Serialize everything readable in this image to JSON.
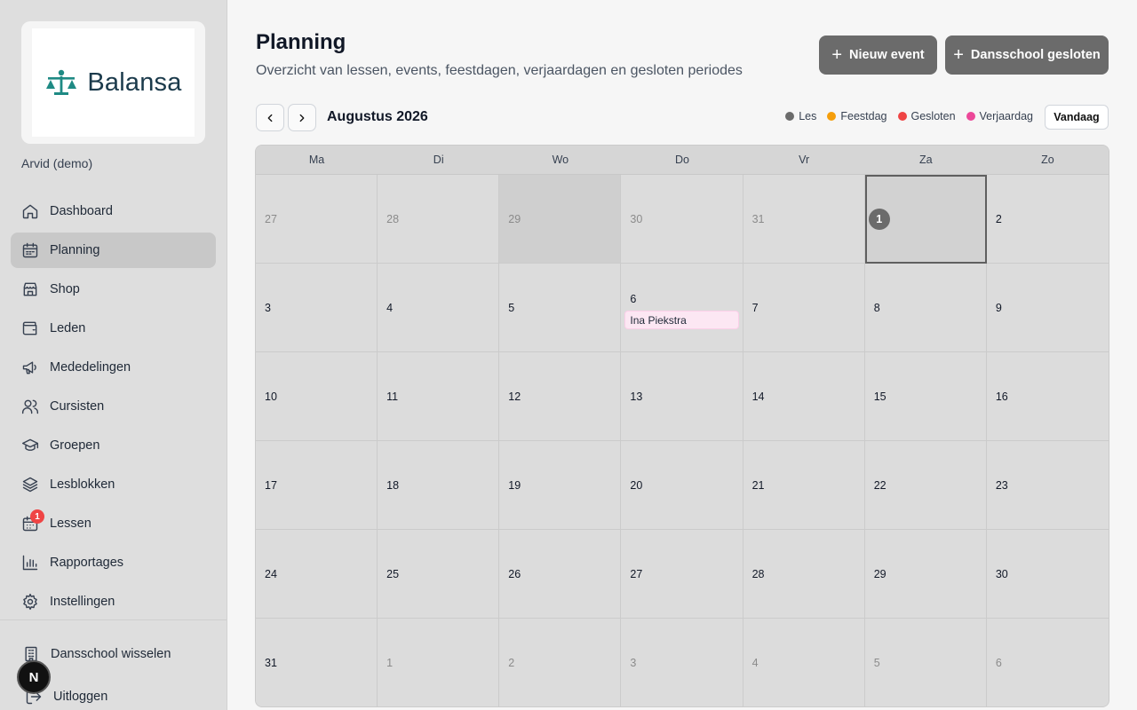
{
  "sidebar": {
    "logo_text": "Balansa",
    "user_name": "Arvid (demo)",
    "items": [
      {
        "label": "Dashboard"
      },
      {
        "label": "Planning"
      },
      {
        "label": "Shop"
      },
      {
        "label": "Leden"
      },
      {
        "label": "Mededelingen"
      },
      {
        "label": "Cursisten"
      },
      {
        "label": "Groepen"
      },
      {
        "label": "Lesblokken"
      },
      {
        "label": "Lessen",
        "badge": "1"
      },
      {
        "label": "Rapportages"
      },
      {
        "label": "Instellingen"
      }
    ],
    "switch_school": "Dansschool wisselen",
    "logout": "Uitloggen",
    "avatar_letter": "N"
  },
  "header": {
    "title": "Planning",
    "subtitle": "Overzicht van lessen, events, feestdagen, verjaardagen en gesloten periodes",
    "new_event": "Nieuw event",
    "school_closed": "Dansschool gesloten"
  },
  "calendar": {
    "month": "Augustus 2026",
    "today_label": "Vandaag",
    "legend": [
      {
        "label": "Les",
        "color": "#6b6b6b"
      },
      {
        "label": "Feestdag",
        "color": "#f59e0b"
      },
      {
        "label": "Gesloten",
        "color": "#ef4444"
      },
      {
        "label": "Verjaardag",
        "color": "#ec4899"
      }
    ],
    "weekdays": [
      "Ma",
      "Di",
      "Wo",
      "Do",
      "Vr",
      "Za",
      "Zo"
    ],
    "days": [
      "27",
      "28",
      "29",
      "30",
      "31",
      "1",
      "2",
      "3",
      "4",
      "5",
      "6",
      "7",
      "8",
      "9",
      "10",
      "11",
      "12",
      "13",
      "14",
      "15",
      "16",
      "17",
      "18",
      "19",
      "20",
      "21",
      "22",
      "23",
      "24",
      "25",
      "26",
      "27",
      "28",
      "29",
      "30",
      "31",
      "1",
      "2",
      "3",
      "4",
      "5",
      "6"
    ],
    "event": {
      "day": "6",
      "label": "Ina Piekstra"
    }
  }
}
